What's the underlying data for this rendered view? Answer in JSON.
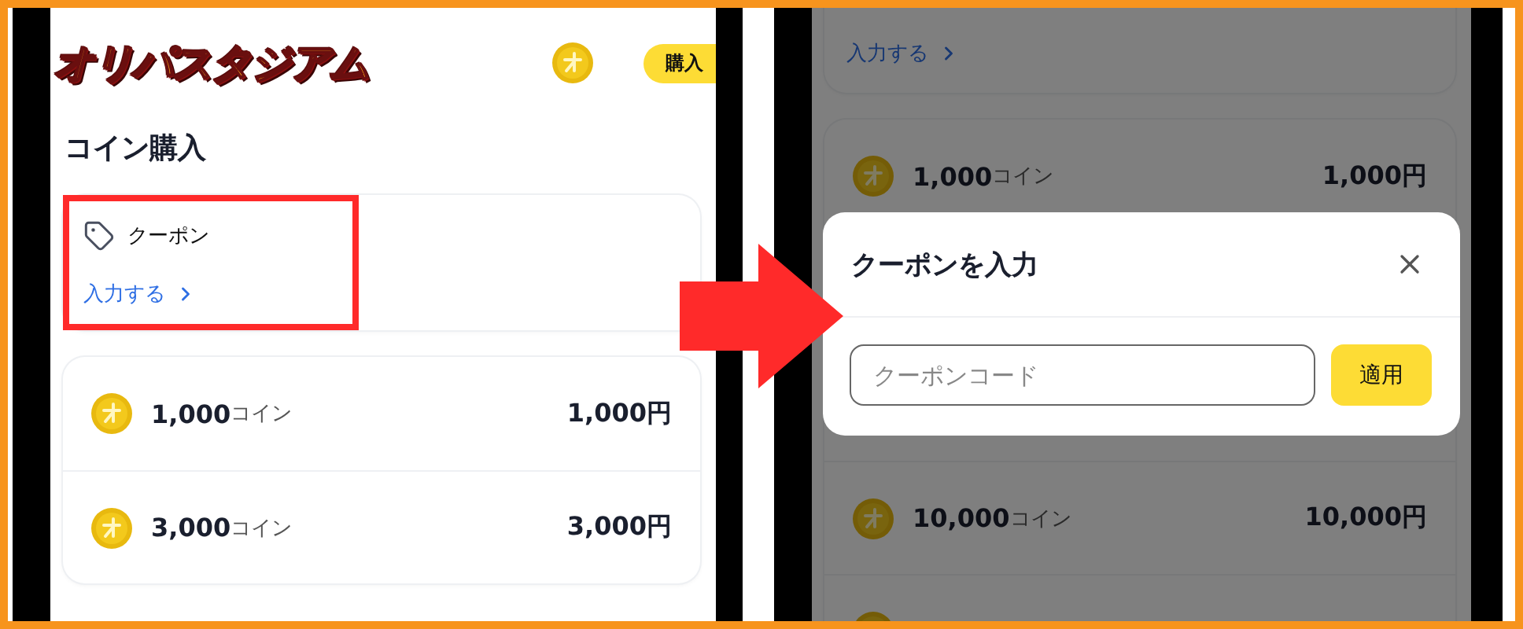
{
  "left_screen": {
    "logo": "オリパスタジアム",
    "buy_button": "購入",
    "title": "コイン購入",
    "coupon": {
      "label": "クーポン",
      "link": "入力する",
      "highlighted": true
    },
    "coin_packs": [
      {
        "coins": "1,000",
        "unit": "コイン",
        "price": "1,000円"
      },
      {
        "coins": "3,000",
        "unit": "コイン",
        "price": "3,000円"
      }
    ]
  },
  "right_screen": {
    "coupon_link": "入力する",
    "coin_packs": [
      {
        "coins": "1,000",
        "unit": "コイン",
        "price": "1,000円"
      },
      {
        "coins": "10,000",
        "unit": "コイン",
        "price": "10,000円"
      }
    ],
    "modal": {
      "title": "クーポンを入力",
      "placeholder": "クーポンコード",
      "apply_button": "適用"
    }
  }
}
